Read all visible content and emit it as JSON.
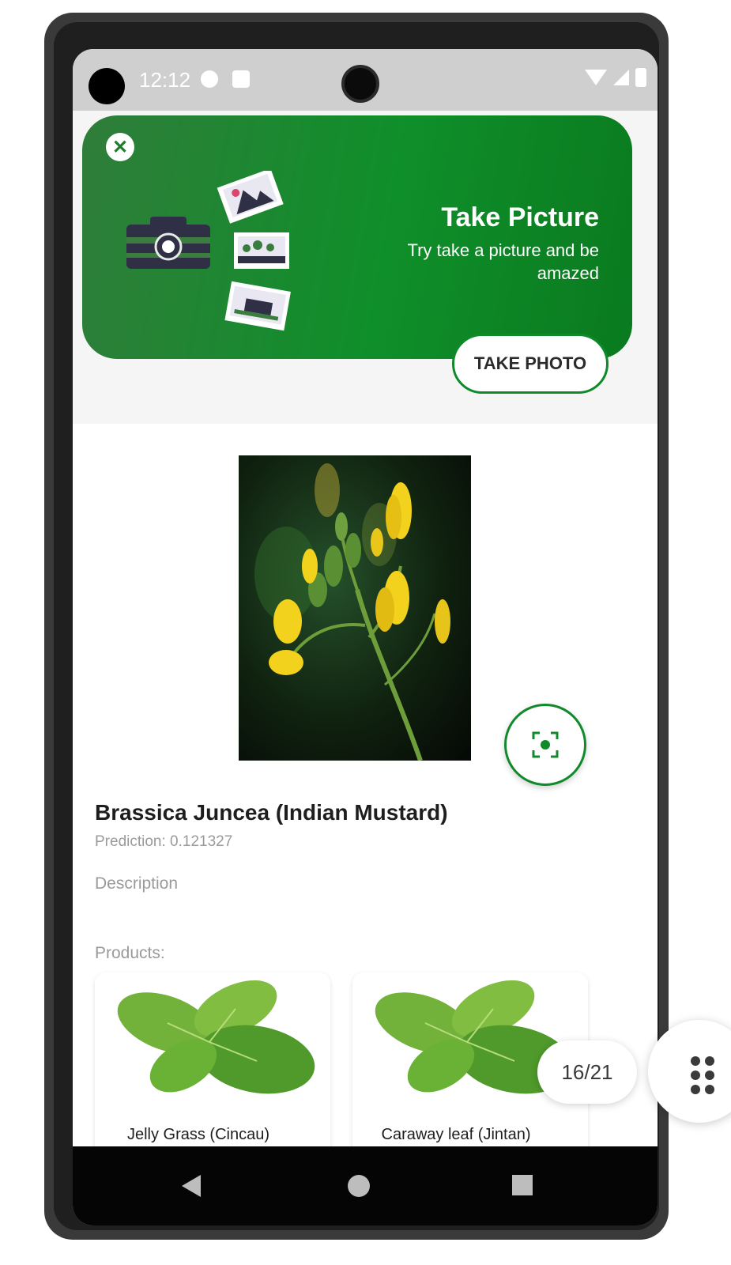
{
  "status_bar": {
    "time": "12:12"
  },
  "banner": {
    "title": "Take Picture",
    "subtitle": "Try take a picture and be amazed",
    "button_label": "TAKE PHOTO",
    "close_symbol": "✕",
    "accent_color": "#0f8a2a"
  },
  "result": {
    "plant_name": "Brassica Juncea (Indian Mustard)",
    "prediction": "Prediction: 0.121327",
    "description_label": "Description",
    "products_label": "Products:",
    "products": [
      {
        "name": "Jelly Grass (Cincau)"
      },
      {
        "name": "Caraway leaf (Jintan)"
      }
    ]
  },
  "overlay": {
    "page_counter": "16/21"
  },
  "icons": {
    "close": "close-icon",
    "scan": "scan-icon",
    "nav_back": "back-triangle-icon",
    "nav_home": "home-circle-icon",
    "nav_recent": "recent-square-icon",
    "grid": "grid-dots-icon"
  }
}
